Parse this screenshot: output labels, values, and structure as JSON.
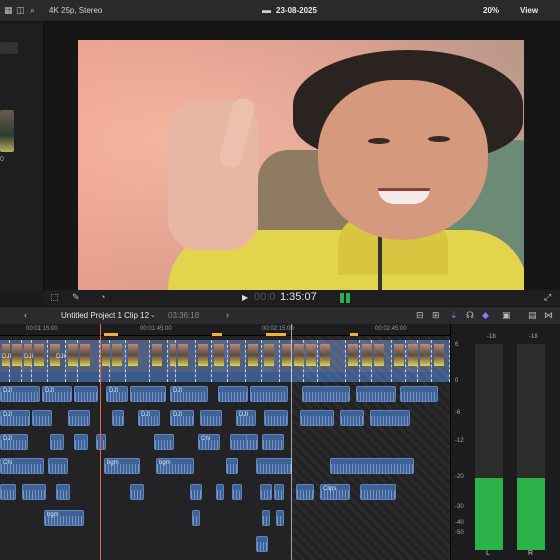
{
  "topbar": {
    "format": "4K 25p, Stereo",
    "date": "23-08-2025",
    "zoom": "20%",
    "view": "View"
  },
  "browser": {
    "clip_label": "0"
  },
  "viewer": {
    "timecode_dim": "00:0",
    "timecode": "1:35:07"
  },
  "timeline_bar": {
    "project_name": "Untitled Project 1 Clip 12",
    "duration": "03:36:18"
  },
  "ruler": {
    "ticks": [
      "00:01:15:00",
      "00:01:45:00",
      "00:02:15:00",
      "00:02:45:00"
    ]
  },
  "storyline_labels": [
    "DJI",
    "DJI",
    "DJI"
  ],
  "audio_clips": {
    "labels": [
      "DJI",
      "DJI",
      "DJI",
      "DJI",
      "DJI",
      "DJI",
      "DJI",
      "DJI",
      "DJI",
      "Chi",
      "bgm",
      "bgm",
      "bgm",
      "bgm",
      "Chi",
      "Chi",
      "Clips",
      "Chi",
      "DJI",
      "Chi",
      "Chi",
      "Chi",
      "bgm",
      "Chi",
      "DJI",
      "DJI"
    ]
  },
  "meters": {
    "scale": [
      "6",
      "0",
      "-6",
      "-12",
      "-20",
      "-30",
      "-40",
      "-50"
    ],
    "peak_left": "-18",
    "peak_right": "-18",
    "level_left": 0.35,
    "level_right": 0.35,
    "channel_left": "L",
    "channel_right": "R"
  },
  "colors": {
    "accent_purple": "#8c7dff",
    "playhead": "#e06a4a",
    "meter_green": "#2bb34a",
    "clip_blue": "#3f6294"
  }
}
